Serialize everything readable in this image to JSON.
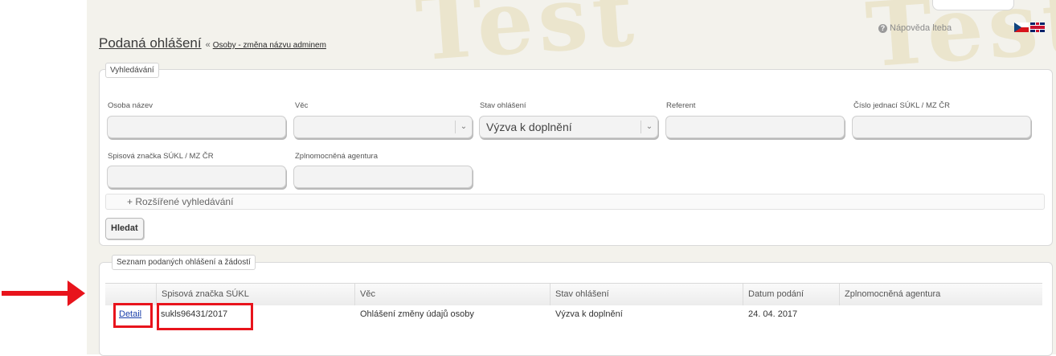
{
  "header": {
    "top_tab": "",
    "help_label": "Nápověda lteba",
    "languages": [
      "cz",
      "gb"
    ]
  },
  "watermark": "Test",
  "title": {
    "page_title": "Podaná ohlášení",
    "separator": "«",
    "breadcrumb_link": "Osoby - změna názvu adminem"
  },
  "search": {
    "legend": "Vyhledávání",
    "fields": {
      "osoba_nazev": {
        "label": "Osoba název",
        "value": ""
      },
      "vec": {
        "label": "Věc",
        "value": ""
      },
      "stav": {
        "label": "Stav ohlášení",
        "value": "Výzva k doplnění"
      },
      "referent": {
        "label": "Referent",
        "value": ""
      },
      "cislo_jednaci": {
        "label": "Číslo jednací SÚKL / MZ ČR",
        "value": ""
      },
      "spisova_znacka": {
        "label": "Spisová značka SÚKL / MZ ČR",
        "value": ""
      },
      "agentura": {
        "label": "Zplnomocněná agentura",
        "value": ""
      }
    },
    "advanced_label": "+ Rozšířené vyhledávání",
    "search_button": "Hledat"
  },
  "results": {
    "legend": "Seznam podaných ohlášení a žádostí",
    "columns": [
      "",
      "Spisová značka SÚKL",
      "Věc",
      "Stav ohlášení",
      "Datum podání",
      "Zplnomocněná agentura"
    ],
    "rows": [
      {
        "action": "Detail",
        "spisova_znacka": "sukls96431/2017",
        "vec": "Ohlášení změny údajů osoby",
        "stav": "Výzva k doplnění",
        "datum": "24. 04. 2017",
        "agentura": ""
      }
    ]
  },
  "annotations": {
    "arrow_color": "#e8141c",
    "box_color": "#e8141c"
  }
}
